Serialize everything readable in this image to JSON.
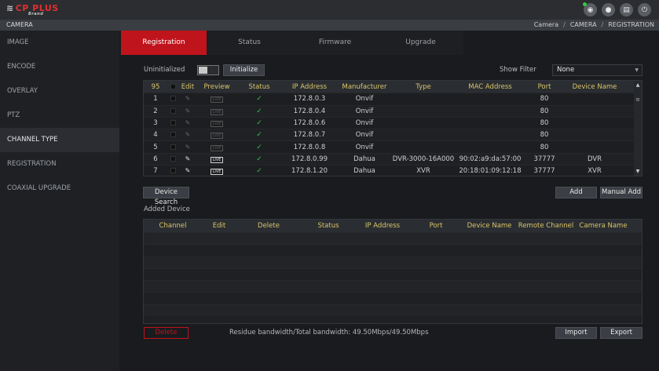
{
  "topbar": {
    "logo_text": "CP PLUS",
    "logo_sub": "Brand",
    "icons": [
      "eye-icon",
      "user-icon",
      "menu-icon",
      "power-icon"
    ]
  },
  "titlebar": {
    "title": "CAMERA",
    "breadcrumb": [
      "Camera",
      "CAMERA",
      "REGISTRATION"
    ]
  },
  "sidebar": {
    "items": [
      {
        "label": "IMAGE"
      },
      {
        "label": "ENCODE"
      },
      {
        "label": "OVERLAY"
      },
      {
        "label": "PTZ"
      },
      {
        "label": "CHANNEL TYPE"
      },
      {
        "label": "REGISTRATION"
      },
      {
        "label": "COAXIAL UPGRADE"
      }
    ]
  },
  "tabs": [
    {
      "label": "Registration"
    },
    {
      "label": "Status"
    },
    {
      "label": "Firmware"
    },
    {
      "label": "Upgrade"
    }
  ],
  "toolbar": {
    "uninitialized_label": "Uninitialized",
    "initialize_button": "Initialize",
    "show_filter_label": "Show Filter",
    "filter_value": "None"
  },
  "device_table": {
    "count": "95",
    "headers": [
      "Edit",
      "Preview",
      "Status",
      "IP Address",
      "Manufacturer",
      "Type",
      "MAC Address",
      "Port",
      "Device Name"
    ],
    "rows": [
      {
        "num": "1",
        "ip": "172.8.0.3",
        "manufacturer": "Onvif",
        "type": "",
        "mac": "",
        "port": "80",
        "name": ""
      },
      {
        "num": "2",
        "ip": "172.8.0.4",
        "manufacturer": "Onvif",
        "type": "",
        "mac": "",
        "port": "80",
        "name": ""
      },
      {
        "num": "3",
        "ip": "172.8.0.6",
        "manufacturer": "Onvif",
        "type": "",
        "mac": "",
        "port": "80",
        "name": ""
      },
      {
        "num": "4",
        "ip": "172.8.0.7",
        "manufacturer": "Onvif",
        "type": "",
        "mac": "",
        "port": "80",
        "name": ""
      },
      {
        "num": "5",
        "ip": "172.8.0.8",
        "manufacturer": "Onvif",
        "type": "",
        "mac": "",
        "port": "80",
        "name": ""
      },
      {
        "num": "6",
        "ip": "172.8.0.99",
        "manufacturer": "Dahua",
        "type": "DVR-3000-16A000",
        "mac": "90:02:a9:da:57:00",
        "port": "37777",
        "name": "DVR"
      },
      {
        "num": "7",
        "ip": "172.8.1.20",
        "manufacturer": "Dahua",
        "type": "XVR",
        "mac": "20:18:01:09:12:18",
        "port": "37777",
        "name": "XVR"
      }
    ]
  },
  "actions": {
    "device_search": "Device Search",
    "add": "Add",
    "manual_add": "Manual Add",
    "added_device_label": "Added Device"
  },
  "added_table": {
    "headers": [
      "Channel",
      "Edit",
      "Delete",
      "Status",
      "IP Address",
      "Port",
      "Device Name",
      "Remote Channel",
      "Camera Name"
    ]
  },
  "bottom": {
    "delete": "Delete",
    "bandwidth_text": "Residue bandwidth/Total bandwidth: 49.50Mbps/49.50Mbps",
    "import": "Import",
    "export": "Export"
  },
  "preview_badge": "LIVE",
  "colors": {
    "accent_red": "#c0141c",
    "header_gold": "#d9c46a",
    "status_green": "#2fc25b"
  }
}
